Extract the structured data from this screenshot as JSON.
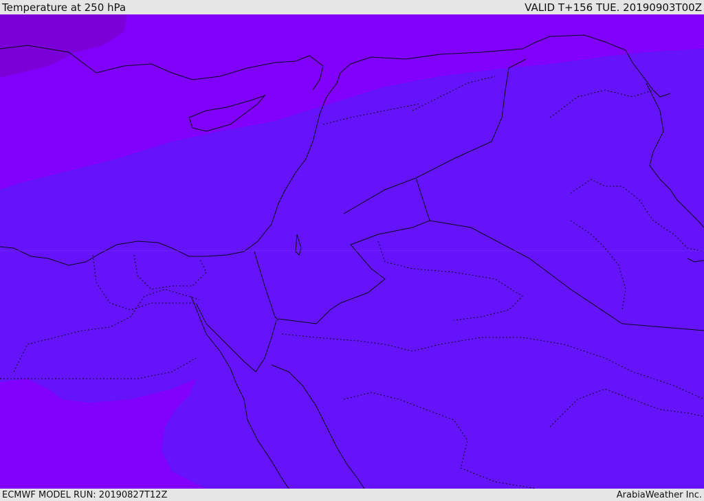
{
  "header": {
    "title": "Temperature at 250 hPa",
    "valid": "VALID T+156 TUE. 20190903T00Z"
  },
  "footer": {
    "model_run": "ECMWF MODEL RUN: 20190827T12Z",
    "credit": "ArabiaWeather Inc."
  },
  "map": {
    "colors": {
      "warm_band": "#8000fb",
      "main": "#6513fb",
      "coldest_patch": "#7a00d8",
      "border": "#0a0a1a"
    }
  }
}
